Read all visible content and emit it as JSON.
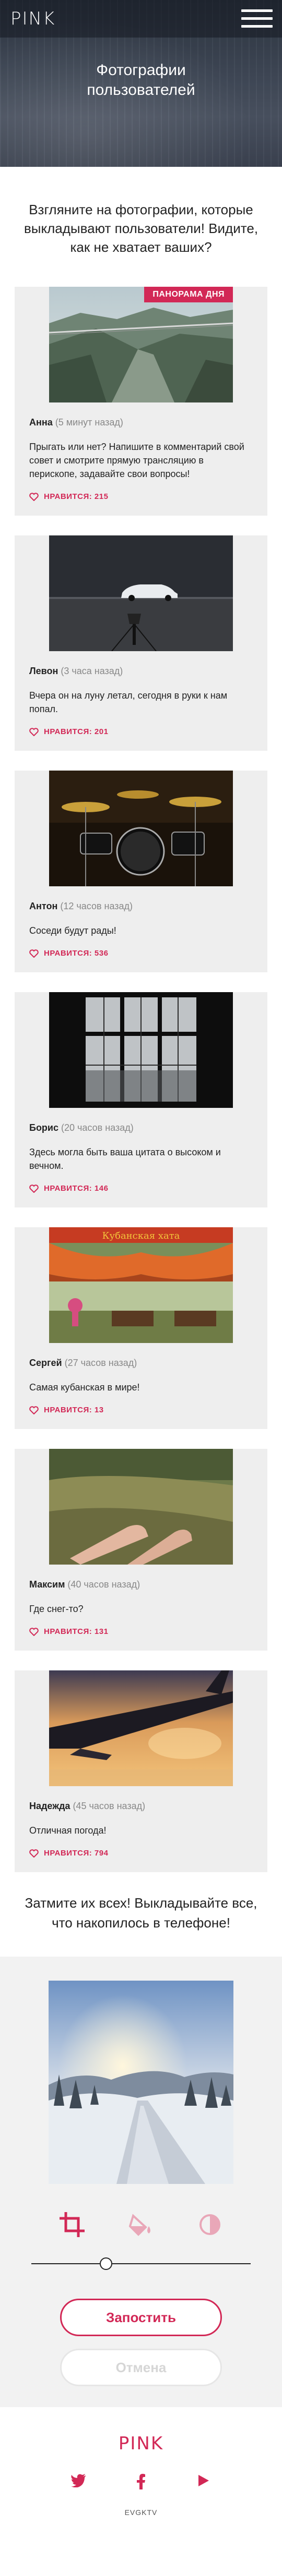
{
  "header": {
    "logo": "PINK",
    "title": "Фотографии пользователей"
  },
  "intro": "Взгляните на фотографии, которые выкладывают пользователи! Видите, как не хватает ваших?",
  "feed": {
    "badge": "ПАНОРАМА ДНЯ",
    "posts": [
      {
        "author": "Анна",
        "time": "(5 минут назад)",
        "text": "Прыгать или нет? Напишите в комментарий свой совет и смотрите прямую трансляцию в перископе, задавайте свои вопросы!",
        "likes": "НРАВИТСЯ: 215"
      },
      {
        "author": "Левон",
        "time": "(3 часа назад)",
        "text": "Вчера он на луну летал, сегодня в руки к нам попал.",
        "likes": "НРАВИТСЯ: 201"
      },
      {
        "author": "Антон",
        "time": "(12 часов назад)",
        "text": "Соседи будут рады!",
        "likes": "НРАВИТСЯ: 536"
      },
      {
        "author": "Борис",
        "time": "(20 часов назад)",
        "text": "Здесь могла быть ваша цитата о высоком и вечном.",
        "likes": "НРАВИТСЯ: 146"
      },
      {
        "author": "Сергей",
        "time": "(27 часов назад)",
        "text": "Самая кубанская в мире!",
        "likes": "НРАВИТСЯ: 13"
      },
      {
        "author": "Максим",
        "time": "(40 часов назад)",
        "text": "Где снег-то?",
        "likes": "НРАВИТСЯ: 131"
      },
      {
        "author": "Надежда",
        "time": "(45 часов назад)",
        "text": "Отличная погода!",
        "likes": "НРАВИТСЯ: 794"
      }
    ]
  },
  "photo_signs": {
    "post5": "Кубанская хата"
  },
  "upload": {
    "intro": "Затмите их всех! Выкладывайте все, что накопилось в телефоне!",
    "slider_value_pct": 33,
    "publish_label": "Запостить",
    "cancel_label": "Отмена"
  },
  "footer": {
    "logo": "PINK",
    "copyright": "EVGKTV"
  },
  "colors": {
    "accent": "#d22856",
    "feed_bg": "#eeeeee",
    "hero_bg": "#3b4250"
  },
  "icons": {
    "menu": "burger-icon",
    "like": "heart-icon",
    "crop": "crop-icon",
    "fill": "fill-icon",
    "contrast": "contrast-icon",
    "twitter": "twitter-icon",
    "facebook": "facebook-icon",
    "youtube": "youtube-icon"
  }
}
